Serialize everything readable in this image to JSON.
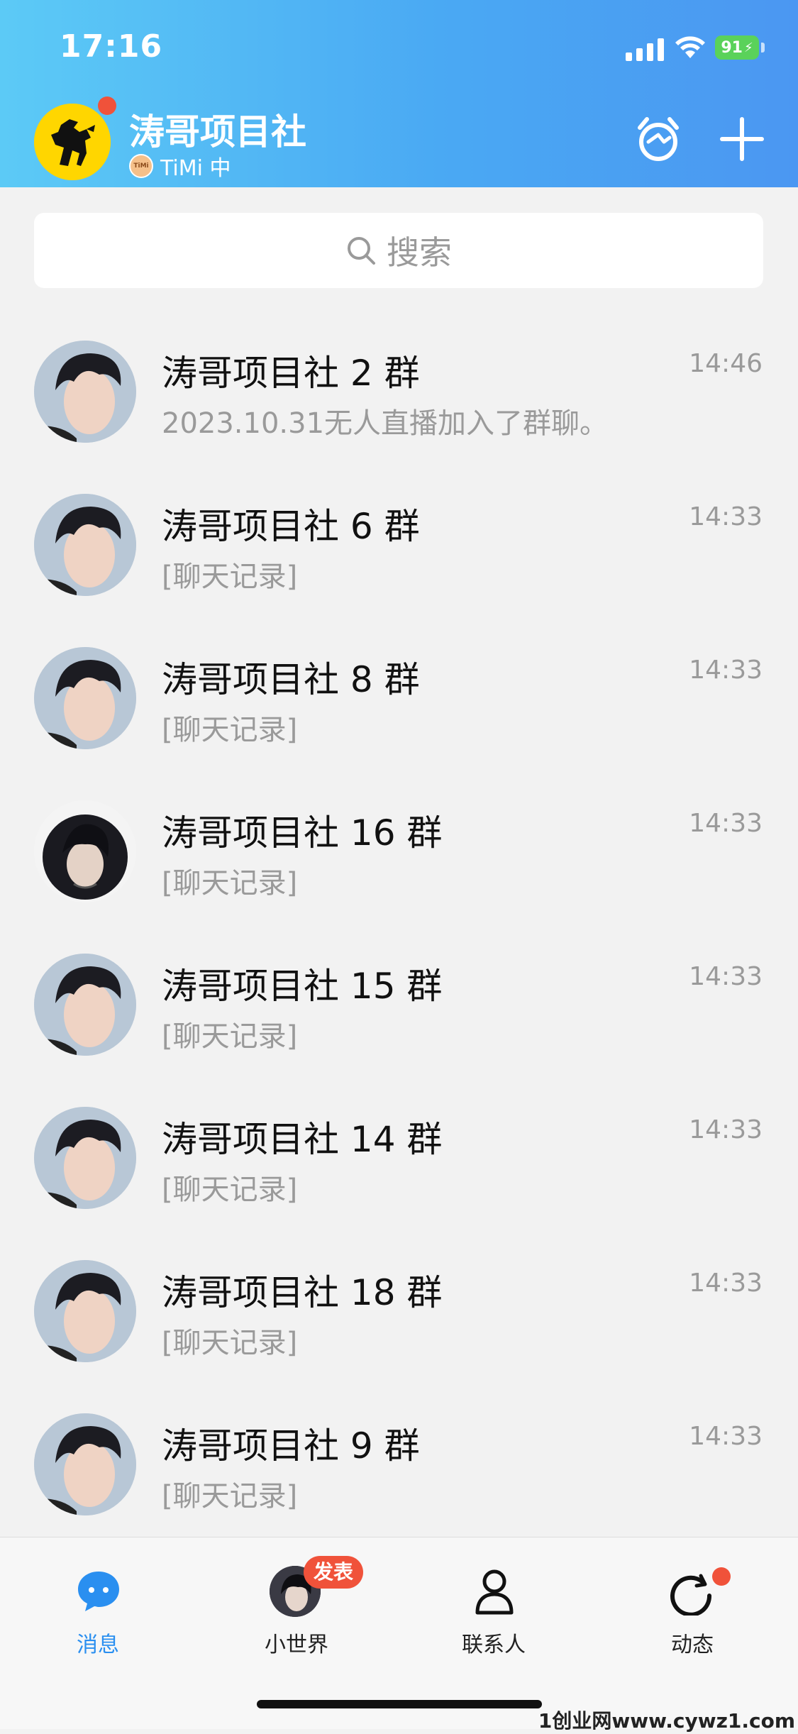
{
  "status_bar": {
    "time": "17:16",
    "battery": "91"
  },
  "header": {
    "title": "涛哥项目社",
    "status_badge": "TiMi",
    "status_text": "TiMi 中"
  },
  "search": {
    "placeholder": "搜索"
  },
  "chats": [
    {
      "name": "涛哥项目社 2 群",
      "preview": "2023.10.31无人直播加入了群聊。",
      "time": "14:46"
    },
    {
      "name": "涛哥项目社 6 群",
      "preview": "[聊天记录]",
      "time": "14:33"
    },
    {
      "name": "涛哥项目社 8 群",
      "preview": "[聊天记录]",
      "time": "14:33"
    },
    {
      "name": "涛哥项目社 16 群",
      "preview": "[聊天记录]",
      "time": "14:33"
    },
    {
      "name": "涛哥项目社 15 群",
      "preview": "[聊天记录]",
      "time": "14:33"
    },
    {
      "name": "涛哥项目社 14 群",
      "preview": "[聊天记录]",
      "time": "14:33"
    },
    {
      "name": "涛哥项目社 18 群",
      "preview": "[聊天记录]",
      "time": "14:33"
    },
    {
      "name": "涛哥项目社 9 群",
      "preview": "[聊天记录]",
      "time": "14:33"
    }
  ],
  "tabs": [
    {
      "label": "消息",
      "icon": "chat-bubble-icon",
      "active": true
    },
    {
      "label": "小世界",
      "icon": "avatar-icon",
      "badge": "发表"
    },
    {
      "label": "联系人",
      "icon": "person-icon"
    },
    {
      "label": "动态",
      "icon": "refresh-star-icon"
    }
  ],
  "watermark": "1创业网www.cywz1.com",
  "colors": {
    "accent": "#2a8ff0",
    "badge_red": "#f0523a",
    "header_start": "#5ccaf6",
    "header_end": "#4b97f2"
  }
}
